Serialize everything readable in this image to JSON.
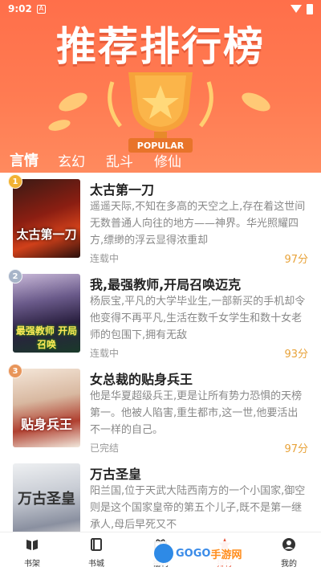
{
  "status_bar": {
    "time": "9:02",
    "notif": "A"
  },
  "banner": {
    "title": "推荐排行榜",
    "badge": "POPULAR"
  },
  "tabs": [
    "言情",
    "玄幻",
    "乱斗",
    "修仙"
  ],
  "books": [
    {
      "rank": "1",
      "title": "太古第一刀",
      "desc": "遥遥天际,不知在多高的天空之上,存在着这世间无数普通人向往的地方——神界。华光照耀四方,缥缈的浮云显得浓重却",
      "status": "连载中",
      "score": "97分",
      "rank_color": "#f2b233",
      "cover_text": "太古第一刀"
    },
    {
      "rank": "2",
      "title": "我,最强教师,开局召唤迈克",
      "desc": "杨辰宝,平凡的大学毕业生,一部新买的手机却令他变得不再平凡,生活在数千女学生和数十女老师的包围下,拥有无敌",
      "status": "连载中",
      "score": "93分",
      "rank_color": "#a7b4c8",
      "cover_text": "最强教师 开局召唤"
    },
    {
      "rank": "3",
      "title": "女总裁的贴身兵王",
      "desc": "他是华夏超级兵王,更是让所有势力恐惧的天榜第一。他被人陷害,重生都市,这一世,他要活出不一样的自己。",
      "status": "已完结",
      "score": "97分",
      "rank_color": "#e8955a",
      "cover_text": "贴身兵王"
    },
    {
      "rank": "",
      "title": "万古圣皇",
      "desc": "阳兰国,位于天武大陆西南方的一个小国家,御空则是这个国家皇帝的第五个儿子,既不是第一继承人,母后早死又不",
      "status": "",
      "score": "",
      "rank_color": "",
      "cover_text": "万古圣皇"
    }
  ],
  "nav": [
    "书架",
    "书城",
    "福利",
    "排行",
    "我的"
  ],
  "watermark": {
    "brand": "GOGO",
    "suffix": "手游网"
  }
}
